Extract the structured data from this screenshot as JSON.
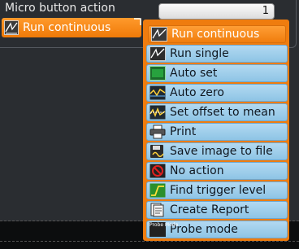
{
  "header": {
    "title": "Micro button action",
    "value": "1"
  },
  "selector": {
    "label": "Run continuous"
  },
  "menu": {
    "items": [
      {
        "label": "Run continuous",
        "icon": "run-continuous-icon"
      },
      {
        "label": "Run single",
        "icon": "run-single-icon"
      },
      {
        "label": "Auto set",
        "icon": "auto-set-icon"
      },
      {
        "label": "Auto zero",
        "icon": "auto-zero-icon"
      },
      {
        "label": "Set offset to mean",
        "icon": "offset-icon"
      },
      {
        "label": "Print",
        "icon": "printer-icon"
      },
      {
        "label": "Save image to file",
        "icon": "floppy-disk-icon"
      },
      {
        "label": "No action",
        "icon": "no-action-icon"
      },
      {
        "label": "Find trigger level",
        "icon": "trigger-icon"
      },
      {
        "label": "Create Report",
        "icon": "report-icon"
      },
      {
        "label": "Probe mode",
        "icon": "probe-mode-icon",
        "icon_text": "Probe Mode"
      }
    ]
  },
  "colors": {
    "accent": "#f07d0d",
    "menu_item": "#a5d1ee",
    "background": "#2a2d31"
  }
}
